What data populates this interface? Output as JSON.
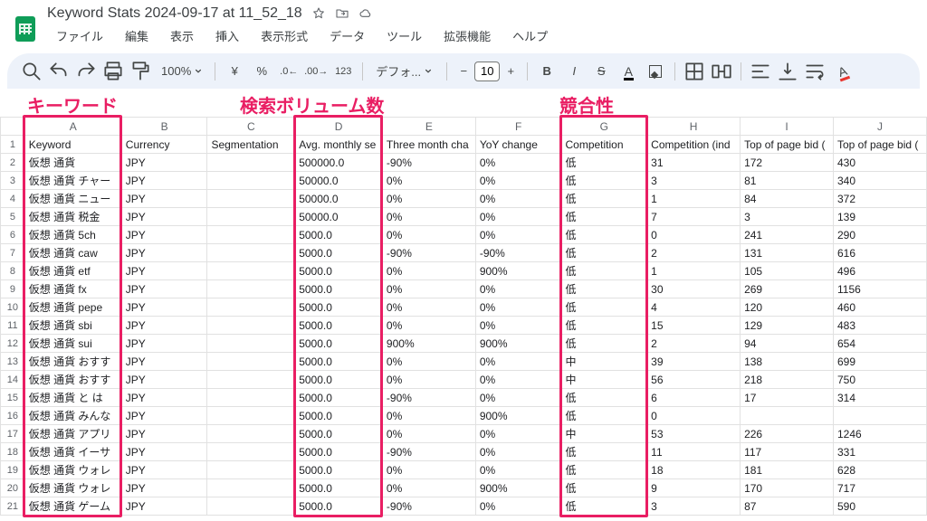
{
  "doc_title": "Keyword Stats 2024-09-17 at 11_52_18",
  "menus": [
    "ファイル",
    "編集",
    "表示",
    "挿入",
    "表示形式",
    "データ",
    "ツール",
    "拡張機能",
    "ヘルプ"
  ],
  "toolbar": {
    "zoom": "100%",
    "font": "デフォ...",
    "font_size": "10"
  },
  "annotations": {
    "keyword": "キーワード",
    "volume": "検索ボリューム数",
    "comp": "競合性"
  },
  "columns": [
    "A",
    "B",
    "C",
    "D",
    "E",
    "F",
    "G",
    "H",
    "I",
    "J"
  ],
  "headers": [
    "Keyword",
    "Currency",
    "Segmentation",
    "Avg. monthly se",
    "Three month cha",
    "YoY change",
    "Competition",
    "Competition (ind",
    "Top of page bid (",
    "Top of page bid ("
  ],
  "rows": [
    [
      "仮想 通貨",
      "JPY",
      "",
      "500000.0",
      "-90%",
      "0%",
      "低",
      "31",
      "172",
      "430"
    ],
    [
      "仮想 通貨 チャー",
      "JPY",
      "",
      "50000.0",
      "0%",
      "0%",
      "低",
      "3",
      "81",
      "340"
    ],
    [
      "仮想 通貨 ニュー",
      "JPY",
      "",
      "50000.0",
      "0%",
      "0%",
      "低",
      "1",
      "84",
      "372"
    ],
    [
      "仮想 通貨 税金",
      "JPY",
      "",
      "50000.0",
      "0%",
      "0%",
      "低",
      "7",
      "3",
      "139"
    ],
    [
      "仮想 通貨 5ch",
      "JPY",
      "",
      "5000.0",
      "0%",
      "0%",
      "低",
      "0",
      "241",
      "290"
    ],
    [
      "仮想 通貨 caw",
      "JPY",
      "",
      "5000.0",
      "-90%",
      "-90%",
      "低",
      "2",
      "131",
      "616"
    ],
    [
      "仮想 通貨 etf",
      "JPY",
      "",
      "5000.0",
      "0%",
      "900%",
      "低",
      "1",
      "105",
      "496"
    ],
    [
      "仮想 通貨 fx",
      "JPY",
      "",
      "5000.0",
      "0%",
      "0%",
      "低",
      "30",
      "269",
      "1156"
    ],
    [
      "仮想 通貨 pepe",
      "JPY",
      "",
      "5000.0",
      "0%",
      "0%",
      "低",
      "4",
      "120",
      "460"
    ],
    [
      "仮想 通貨 sbi",
      "JPY",
      "",
      "5000.0",
      "0%",
      "0%",
      "低",
      "15",
      "129",
      "483"
    ],
    [
      "仮想 通貨 sui",
      "JPY",
      "",
      "5000.0",
      "900%",
      "900%",
      "低",
      "2",
      "94",
      "654"
    ],
    [
      "仮想 通貨 おすす",
      "JPY",
      "",
      "5000.0",
      "0%",
      "0%",
      "中",
      "39",
      "138",
      "699"
    ],
    [
      "仮想 通貨 おすす",
      "JPY",
      "",
      "5000.0",
      "0%",
      "0%",
      "中",
      "56",
      "218",
      "750"
    ],
    [
      "仮想 通貨 と は",
      "JPY",
      "",
      "5000.0",
      "-90%",
      "0%",
      "低",
      "6",
      "17",
      "314"
    ],
    [
      "仮想 通貨 みんな",
      "JPY",
      "",
      "5000.0",
      "0%",
      "900%",
      "低",
      "0",
      "",
      ""
    ],
    [
      "仮想 通貨 アプリ",
      "JPY",
      "",
      "5000.0",
      "0%",
      "0%",
      "中",
      "53",
      "226",
      "1246"
    ],
    [
      "仮想 通貨 イーサ",
      "JPY",
      "",
      "5000.0",
      "-90%",
      "0%",
      "低",
      "11",
      "117",
      "331"
    ],
    [
      "仮想 通貨 ウォレ",
      "JPY",
      "",
      "5000.0",
      "0%",
      "0%",
      "低",
      "18",
      "181",
      "628"
    ],
    [
      "仮想 通貨 ウォレ",
      "JPY",
      "",
      "5000.0",
      "0%",
      "900%",
      "低",
      "9",
      "170",
      "717"
    ],
    [
      "仮想 通貨 ゲーム",
      "JPY",
      "",
      "5000.0",
      "-90%",
      "0%",
      "低",
      "3",
      "87",
      "590"
    ]
  ]
}
